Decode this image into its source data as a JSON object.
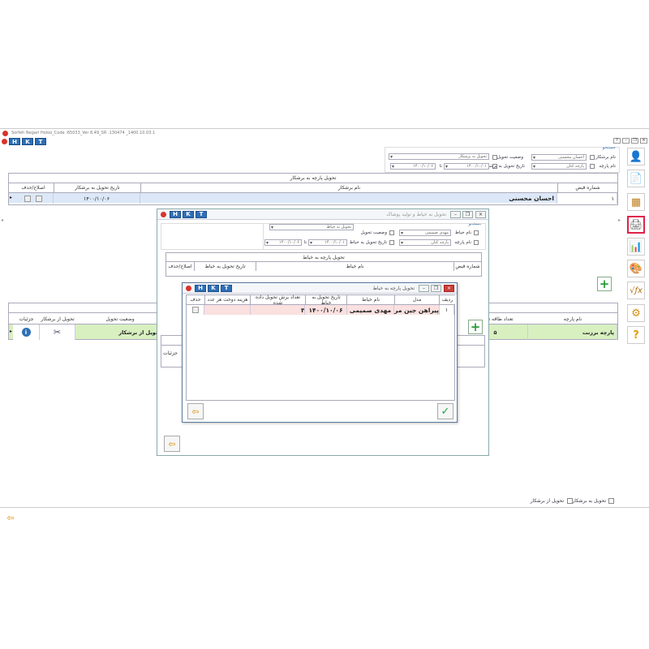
{
  "app": {
    "title": "Sorfeh Negari Holoo_Code :65033_Ver 8.49_SR :130474 _1400.10.03.1",
    "tb_h": "H",
    "tb_k": "K",
    "tb_t": "T"
  },
  "main": {
    "filter_group": "جستجو",
    "filter_name_label": "نام برشکار",
    "filter_name_value": "احسان محسنی",
    "filter_part_label": "نام پارچه",
    "filter_part_value": "پارچه کتان",
    "filter_status_label": "وضعیت تحویل",
    "filter_status_value": "تحویل به برشکار",
    "filter_date_label": "تاریخ تحویل به برشکار",
    "date_from": "۱۴۰۰/۱۰/۰۱",
    "date_to": "۱۴۰۰/۱۰/۰۶",
    "date_sep": "تا",
    "table_title": "تحویل پارچه به برشکار",
    "col_receipt": "شماره قبض",
    "col_cutter": "نام برشکار",
    "col_date": "تاریخ تحویل به برشکار",
    "col_edit": "اصلاح/حذف",
    "row_receipt": "۱",
    "row_cutter": "احسان محسنی",
    "row_date": "۱۴۰۰/۱۰/۰۶",
    "details_title": "جزئیات تحویل به برشکار",
    "col_part": "نام پارچه",
    "col_layers": "تعداد طاقه تحویل",
    "col_status": "وضعیت تحویل",
    "col_from_cutter": "تحویل از برشکار",
    "col_details": "جزئیات",
    "drow_part": "پارچه برزنت",
    "drow_layers": "۵",
    "drow_status": "تحویل از برشکار",
    "footer_chk1": "تحویل به برشکار",
    "footer_chk2": "تحویل از برشکار"
  },
  "tailor_win": {
    "title": "تحویل به خیاط و تولید پوشاک",
    "filter_group": "جستجو",
    "name_label": "نام خیاط",
    "name_value": "مهدی صمیمی",
    "part_label": "نام پارچه",
    "part_value": "پارچه کتان",
    "status_label": "وضعیت تحویل",
    "status_value": "تحویل به خیاط",
    "date_label": "تاریخ تحویل به خیاط",
    "date_from": "۱۴۰۰/۱۰/۰۱",
    "date_to": "۱۴۰۰/۱۰/۰۶",
    "date_sep": "تا",
    "table_title": "تحویل پارچه به خیاط",
    "col_receipt": "شماره قبض",
    "col_tailor": "نام خیاط",
    "col_date": "تاریخ تحویل به خیاط",
    "col_edit": "اصلاح/حذف"
  },
  "dialog": {
    "title": "تحویل پارچه به خیاط",
    "col_row": "ردیف",
    "col_model": "مدل",
    "col_tailor": "نام خیاط",
    "col_date": "تاریخ تحویل به خیاط",
    "col_count": "تعداد برش تحویل داده شده",
    "col_cost": "هزینه دوخت هر عدد",
    "col_delete": "حذف",
    "row_num": "۱",
    "row_model": "پیراهن جین مردانه",
    "row_tailor": "مهدی صمیمی",
    "row_date": "۱۴۰۰/۱۰/۰۶",
    "row_count": "۳",
    "row_cost": ""
  },
  "colors": {
    "accent": "#2f6fb6",
    "selected_row": "#dce8f8",
    "green_row": "#d8f0c0",
    "pink_row": "#fbe0e0",
    "active_border": "#e0224a"
  },
  "icons": [
    "user-add-icon",
    "document-icon",
    "table-icon",
    "printer-icon",
    "chart-icon",
    "palette-icon",
    "formula-icon",
    "gear-icon",
    "help-icon",
    "plus-icon",
    "exit-icon",
    "check-icon",
    "info-icon",
    "scissors-icon",
    "edit-icon"
  ]
}
